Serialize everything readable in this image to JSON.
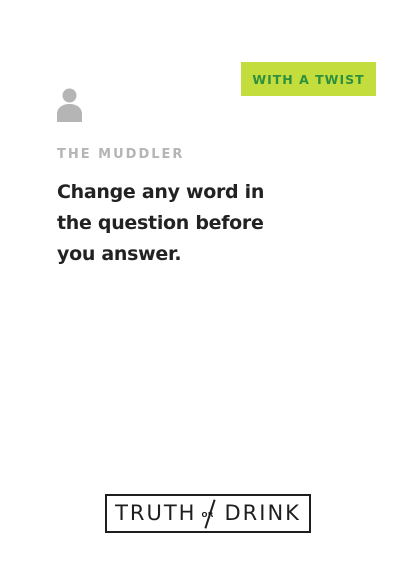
{
  "card": {
    "badge": "WITH A TWIST",
    "name": "THE MUDDLER",
    "prompt": "Change any word in the question before you answer."
  },
  "logo": {
    "left_word": "TRUTH",
    "middle_word": "OR",
    "right_word": "DRINK"
  },
  "colors": {
    "badge_background": "#c3dd3c",
    "badge_text": "#2e8f3e",
    "muted_gray": "#b5b5b5",
    "text_dark": "#222222"
  },
  "icons": {
    "person": "person-silhouette-icon"
  }
}
